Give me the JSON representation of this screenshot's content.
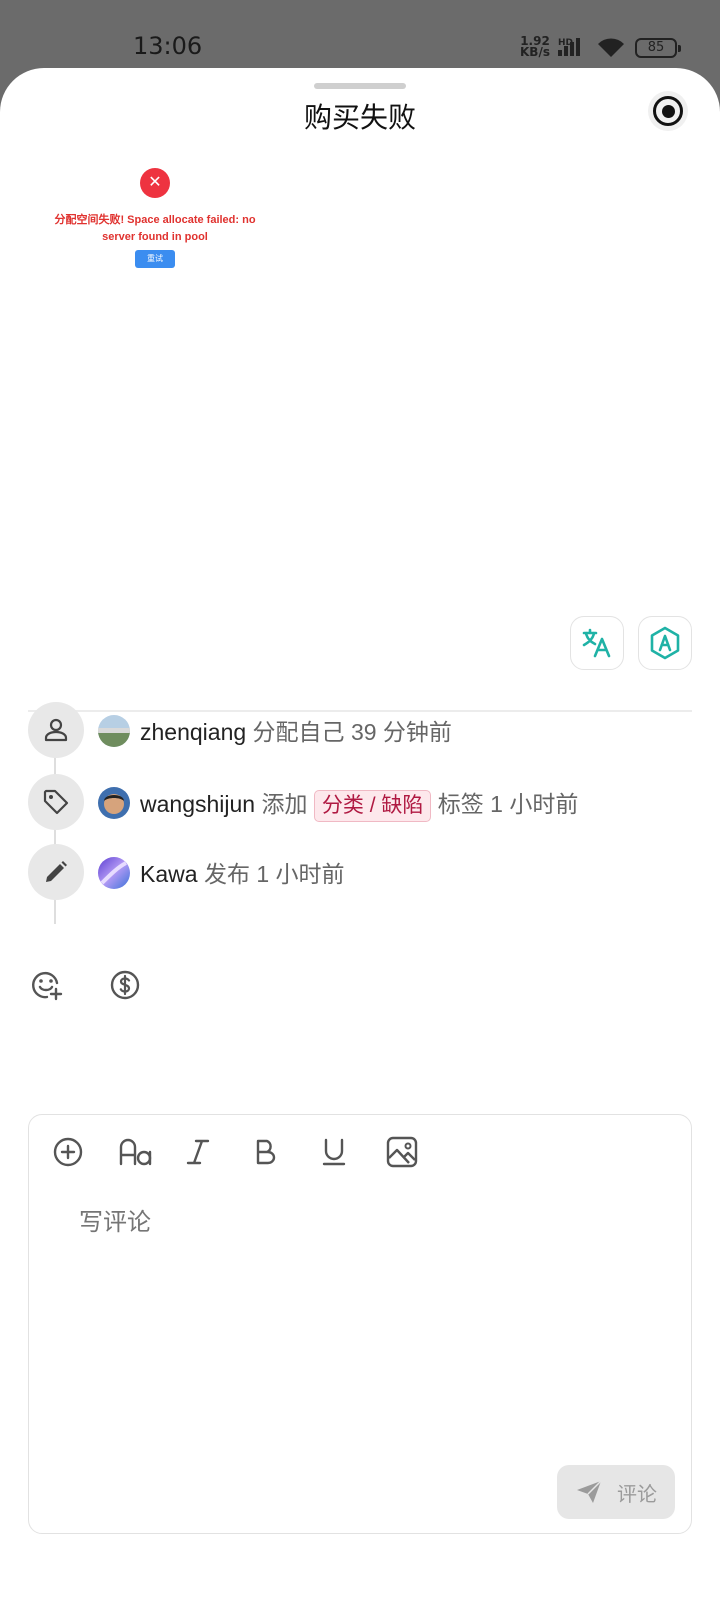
{
  "status_bar": {
    "time": "13:06",
    "net_speed_value": "1.92",
    "net_speed_unit": "KB/s",
    "network_type": "HD",
    "battery": "85"
  },
  "sheet": {
    "title": "购买失败"
  },
  "error_preview": {
    "message": "分配空间失败! Space allocate failed: no server found in pool",
    "retry_label": "重试"
  },
  "activity": [
    {
      "user": "zhenqiang",
      "action": "分配自己",
      "time": "39 分钟前",
      "icon": "person-icon"
    },
    {
      "user": "wangshijun",
      "action": "添加",
      "tag": "分类 / 缺陷",
      "suffix": "标签",
      "time": "1 小时前",
      "icon": "tag-icon"
    },
    {
      "user": "Kawa",
      "action": "发布",
      "time": "1 小时前",
      "icon": "pencil-icon"
    }
  ],
  "reactions": {
    "emoji_icon": "add-emoji-icon",
    "reward_icon": "dollar-icon"
  },
  "editor": {
    "tools": [
      "add-icon",
      "font-size-icon",
      "italic-icon",
      "bold-icon",
      "underline-icon",
      "image-icon"
    ],
    "placeholder": "写评论",
    "send_label": "评论"
  },
  "colors": {
    "accent_teal": "#1fb2a6",
    "error_red": "#ee3340",
    "tag_text": "#b01942",
    "tag_bg": "#fde8ec"
  }
}
